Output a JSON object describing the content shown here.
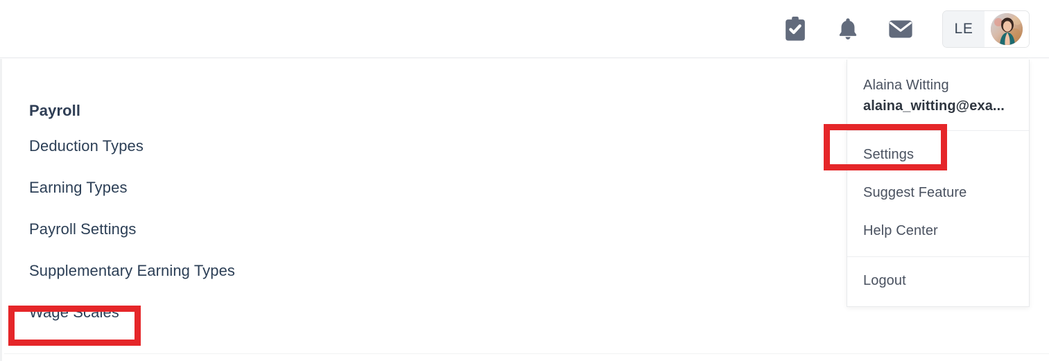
{
  "topbar": {
    "icons": [
      {
        "name": "tasks-icon",
        "label": "Tasks"
      },
      {
        "name": "notifications-icon",
        "label": "Notifications"
      },
      {
        "name": "messages-icon",
        "label": "Messages"
      }
    ],
    "user_pill": {
      "initials": "LE",
      "avatar_alt": "Alaina Witting profile photo"
    }
  },
  "sidebar": {
    "heading": "Payroll",
    "items": [
      {
        "label": "Deduction Types"
      },
      {
        "label": "Earning Types"
      },
      {
        "label": "Payroll Settings"
      },
      {
        "label": "Supplementary Earning Types"
      },
      {
        "label": "Wage Scales"
      }
    ]
  },
  "dropdown": {
    "user_name": "Alaina Witting",
    "user_email": "alaina_witting@exa...",
    "items": [
      {
        "label": "Settings"
      },
      {
        "label": "Suggest Feature"
      },
      {
        "label": "Help Center"
      }
    ],
    "logout_label": "Logout"
  },
  "annotations": {
    "color": "#e52629",
    "boxes": [
      {
        "target": "Settings"
      },
      {
        "target": "Wage Scales"
      }
    ]
  },
  "colors": {
    "accent_red": "#e52629",
    "text_navy": "#2c3f56",
    "icon_gray": "#626b7c",
    "border_gray": "#e6e8ea"
  }
}
